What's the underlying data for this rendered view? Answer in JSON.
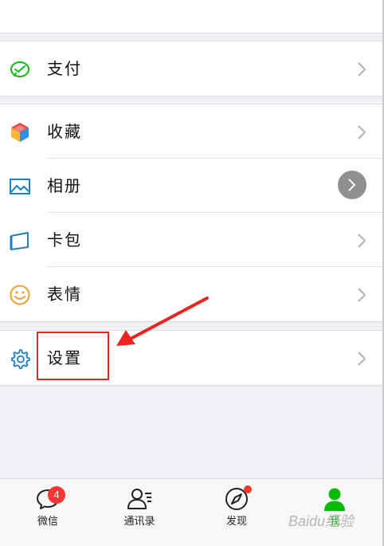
{
  "groups": {
    "pay": {
      "label": "支付"
    },
    "favorites": {
      "label": "收藏"
    },
    "album": {
      "label": "相册"
    },
    "cards": {
      "label": "卡包"
    },
    "stickers": {
      "label": "表情"
    },
    "settings": {
      "label": "设置"
    }
  },
  "tabbar": {
    "chats": {
      "label": "微信",
      "badge": "4"
    },
    "contacts": {
      "label": "通讯录"
    },
    "discover": {
      "label": "发现"
    },
    "me": {
      "label": "我"
    }
  },
  "watermark": "Baidu经验",
  "colors": {
    "accent_green": "#09bb07",
    "annotation_red": "#e8261f",
    "badge_red": "#f43530",
    "icon_blue": "#1a7fcc",
    "icon_orange": "#f0a030"
  }
}
